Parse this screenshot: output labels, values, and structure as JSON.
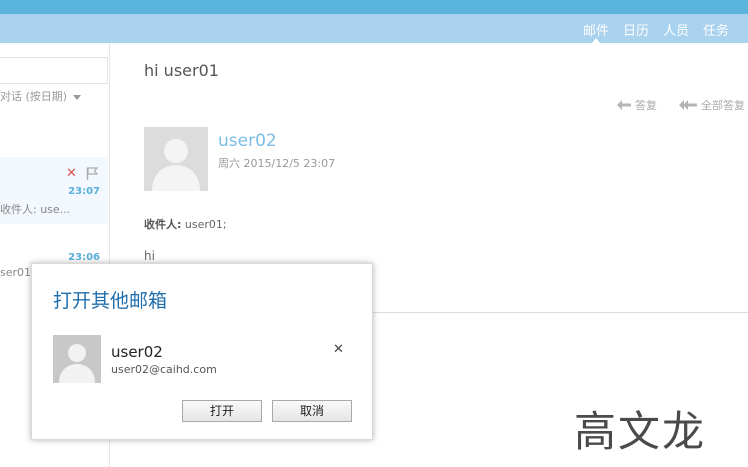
{
  "nav": {
    "tabs": [
      {
        "label": "邮件",
        "active": true
      },
      {
        "label": "日历",
        "active": false
      },
      {
        "label": "人员",
        "active": false
      },
      {
        "label": "任务",
        "active": false
      }
    ]
  },
  "sidebar": {
    "sort_label": "对话 (按日期)",
    "conversations": [
      {
        "time": "23:07",
        "preview": "收件人: use..."
      },
      {
        "time": "23:06",
        "preview": "ser01"
      }
    ]
  },
  "message": {
    "subject": "hi user01",
    "actions": {
      "reply": "答复",
      "reply_all": "全部答复"
    },
    "sender": "user02",
    "date": "周六 2015/12/5 23:07",
    "recipients_label": "收件人:",
    "recipients": "user01;",
    "body": "hi"
  },
  "dialog": {
    "title": "打开其他邮箱",
    "user_name": "user02",
    "user_email": "user02@caihd.com",
    "open_label": "打开",
    "cancel_label": "取消"
  },
  "watermark": "高文龙",
  "colors": {
    "nav_bg": "#a8d2ee",
    "top_strip": "#5ab4dc",
    "accent_link": "#7bbde6",
    "dialog_title": "#1f6fae",
    "delete_red": "#d9534f"
  },
  "icons": [
    "close-icon",
    "flag-icon",
    "reply-arrow-icon",
    "reply-all-arrow-icon",
    "person-icon",
    "caret-down-icon"
  ]
}
